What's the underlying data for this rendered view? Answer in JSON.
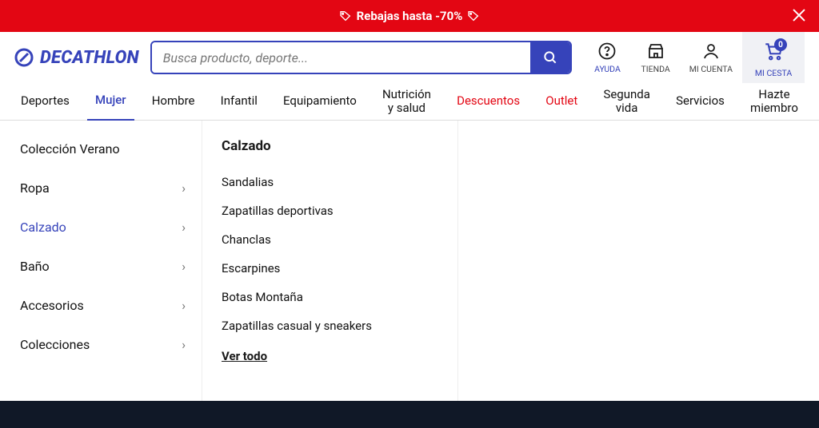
{
  "promo": {
    "text": "Rebajas hasta -70%"
  },
  "search": {
    "placeholder": "Busca producto, deporte..."
  },
  "header_icons": {
    "help": "AYUDA",
    "store": "TIENDA",
    "account": "MI CUENTA",
    "cart": "MI CESTA",
    "cart_count": "0"
  },
  "nav": [
    {
      "label": "Deportes"
    },
    {
      "label": "Mujer",
      "active": true
    },
    {
      "label": "Hombre"
    },
    {
      "label": "Infantil"
    },
    {
      "label": "Equipamiento"
    },
    {
      "label": "Nutrición y salud",
      "two": true,
      "l1": "Nutrición",
      "l2": "y salud"
    },
    {
      "label": "Descuentos",
      "red": true
    },
    {
      "label": "Outlet",
      "red": true
    },
    {
      "label": "Segunda vida",
      "two": true,
      "l1": "Segunda",
      "l2": "vida"
    },
    {
      "label": "Servicios"
    },
    {
      "label": "Hazte miembro",
      "two": true,
      "l1": "Hazte",
      "l2": "miembro"
    }
  ],
  "sidebar": {
    "items": [
      {
        "label": "Colección Verano",
        "chevron": false
      },
      {
        "label": "Ropa",
        "chevron": true
      },
      {
        "label": "Calzado",
        "chevron": true,
        "selected": true
      },
      {
        "label": "Baño",
        "chevron": true
      },
      {
        "label": "Accesorios",
        "chevron": true
      },
      {
        "label": "Colecciones",
        "chevron": true
      }
    ]
  },
  "submenu": {
    "title": "Calzado",
    "links": [
      "Sandalias",
      "Zapatillas deportivas",
      "Chanclas",
      "Escarpines",
      "Botas Montaña",
      "Zapatillas casual y sneakers"
    ],
    "all": "Ver todo"
  },
  "brand": "DECATHLON"
}
